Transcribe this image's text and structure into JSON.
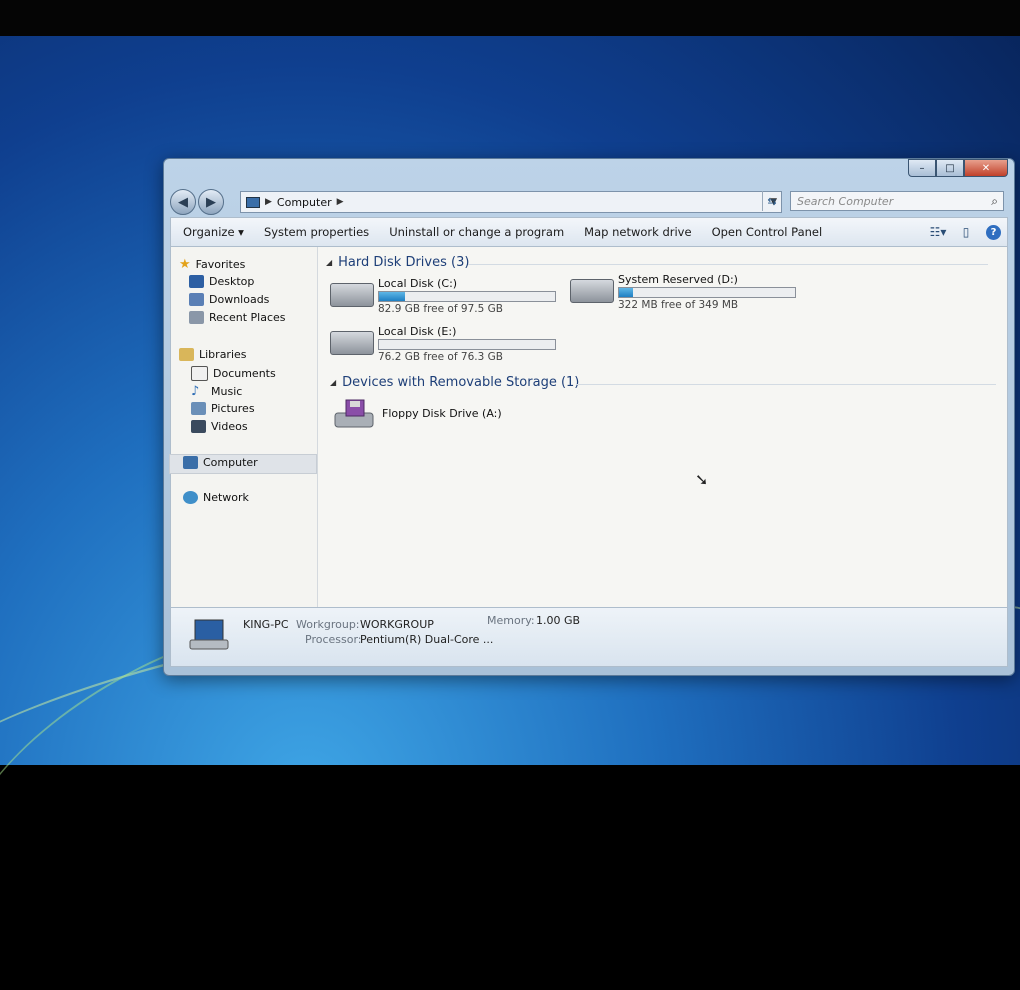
{
  "window": {
    "address": {
      "icon": "computer-icon",
      "path": "Computer"
    },
    "search_placeholder": "Search Computer",
    "caption": {
      "minimize": "–",
      "maximize": "□",
      "close": "✕"
    }
  },
  "toolbar": {
    "organize": "Organize ▾",
    "system_properties": "System properties",
    "uninstall": "Uninstall or change a program",
    "map_drive": "Map network drive",
    "control_panel": "Open Control Panel"
  },
  "nav": {
    "favorites": "Favorites",
    "desktop": "Desktop",
    "downloads": "Downloads",
    "recent": "Recent Places",
    "libraries": "Libraries",
    "documents": "Documents",
    "music": "Music",
    "pictures": "Pictures",
    "videos": "Videos",
    "computer": "Computer",
    "network": "Network"
  },
  "groups": {
    "hdd": "Hard Disk Drives (3)",
    "removable": "Devices with Removable Storage (1)"
  },
  "drives": [
    {
      "name": "Local Disk (C:)",
      "free": "82.9 GB free of 97.5 GB",
      "used_fraction": 0.15
    },
    {
      "name": "System Reserved (D:)",
      "free": "322 MB free of 349 MB",
      "used_fraction": 0.08
    },
    {
      "name": "Local Disk (E:)",
      "free": "76.2 GB free of 76.3 GB",
      "used_fraction": 0.0
    }
  ],
  "floppy": {
    "name": "Floppy Disk Drive (A:)"
  },
  "details": {
    "pc_name": "KING-PC",
    "workgroup_label": "Workgroup:",
    "workgroup": "WORKGROUP",
    "memory_label": "Memory:",
    "memory": "1.00 GB",
    "processor_label": "Processor:",
    "processor": "Pentium(R) Dual-Core ..."
  },
  "colors": {
    "accent": "#1f7fc2",
    "group_header": "#1e3f78"
  }
}
